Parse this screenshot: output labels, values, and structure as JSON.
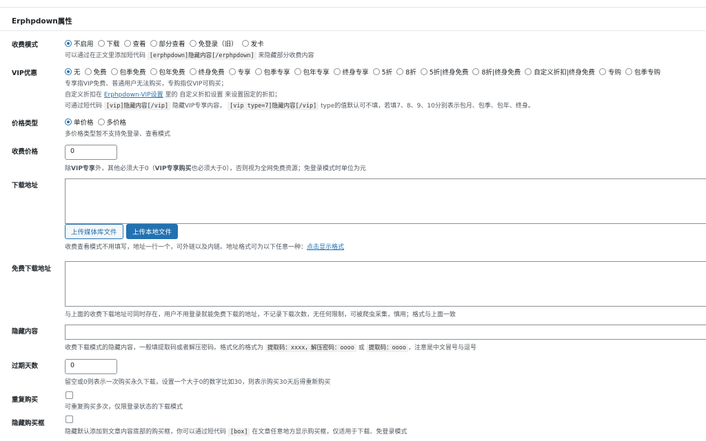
{
  "panel_title": "Erphpdown属性",
  "fee_mode": {
    "label": "收费模式",
    "options": [
      "不启用",
      "下载",
      "查看",
      "部分查看",
      "免登录（旧）",
      "发卡"
    ],
    "selected": 0,
    "desc_a": "可以通过在正文里添加短代码 ",
    "desc_code": "[erphpdown]隐藏内容[/erphpdown]",
    "desc_b": " 来隐藏部分收费内容"
  },
  "vip": {
    "label": "VIP优惠",
    "options": [
      "无",
      "免费",
      "包季免费",
      "包年免费",
      "终身免费",
      "专享",
      "包季专享",
      "包年专享",
      "终身专享",
      "5折",
      "8折",
      "5折|终身免费",
      "8折|终身免费",
      "自定义折扣|终身免费",
      "专购",
      "包季专购"
    ],
    "selected": 0,
    "desc1": "专享指VIP免费、普通用户无法购买，专购指仅VIP可购买；",
    "desc2_a": "自定义折扣在 ",
    "desc2_link": "Erphpdown-VIP设置",
    "desc2_b": " 里的 自定义折扣设置 来设置固定的折扣；",
    "desc3_a": "可通过短代码 ",
    "desc3_code1": "[vip]隐藏内容[/vip]",
    "desc3_b": " 隐藏VIP专享内容， ",
    "desc3_code2": "[vip type=7]隐藏内容[/vip]",
    "desc3_c": " type的值默认可不填，若填7、8、9、10分别表示包月、包季、包年、终身。"
  },
  "price_type": {
    "label": "价格类型",
    "options": [
      "单价格",
      "多价格"
    ],
    "selected": 0,
    "desc": "多价格类型暂不支持免登录、查看模式"
  },
  "price": {
    "label": "收费价格",
    "value": "0",
    "desc_a": "除",
    "desc_b1": "VIP专享",
    "desc_c": "外，其他必须大于0（",
    "desc_b2": "VIP专享购买",
    "desc_d": "也必须大于0），否则视为全网免费资源；免登录模式时单位为元"
  },
  "download": {
    "label": "下载地址",
    "btn_media": "上传媒体库文件",
    "btn_local": "上传本地文件",
    "desc_a": "收费查看模式不用填写，地址一行一个，可外链以及内链。地址格式可为以下任意一种：",
    "desc_link": "点击显示格式"
  },
  "free_download": {
    "label": "免费下载地址",
    "desc": "与上面的收费下载地址可同时存在，用户不用登录就能免费下载的地址，不记录下载次数，无任何限制，可被爬虫采集，慎用；格式与上面一致"
  },
  "hidden": {
    "label": "隐藏内容",
    "desc_a": "收费下载模式的隐藏内容，一般填提取码或者解压密码。格式化的格式为 ",
    "desc_code1": "提取码：xxxx，解压密码：oooo",
    "desc_b": " 或 ",
    "desc_code2": "提取码：oooo",
    "desc_c": "，注意是中文冒号与逗号"
  },
  "expire": {
    "label": "过期天数",
    "value": "0",
    "desc": "留空或0则表示一次购买永久下载，设置一个大于0的数字比如30，则表示购买30天后得重新购买"
  },
  "repeat": {
    "label": "重复购买",
    "checked": false,
    "desc": "可重复购买多次，仅限登录状态的下载模式"
  },
  "hide_box": {
    "label": "隐藏购买框",
    "checked": false,
    "desc_a": "隐藏默认添加到文章内容底部的购买框，你可以通过短代码 ",
    "desc_code": "[box]",
    "desc_b": " 在文章任意地方显示购买框，仅适用于下载、免登录模式"
  }
}
